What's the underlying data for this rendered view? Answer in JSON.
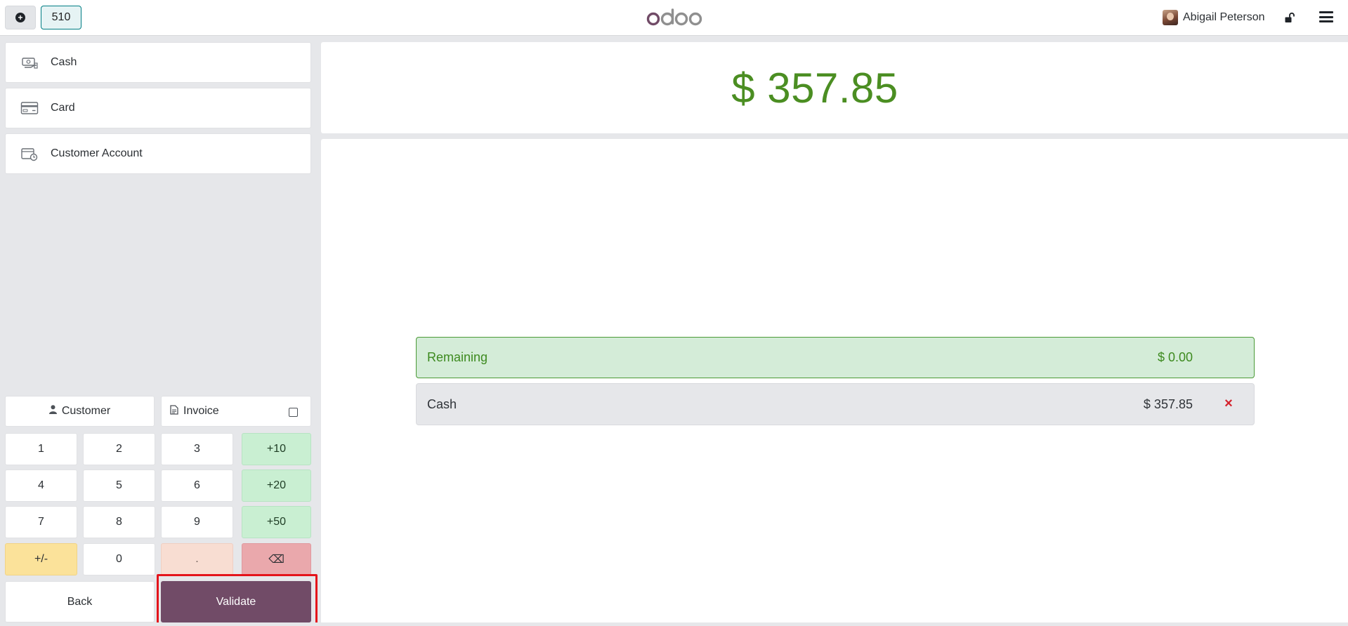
{
  "header": {
    "new_order_icon": "plus-circle-icon",
    "order_tab_label": "510",
    "logo_text": "odoo",
    "user_name": "Abigail Peterson",
    "lock_icon": "unlocked-icon",
    "menu_icon": "hamburger-icon"
  },
  "payment_methods": [
    {
      "label": "Cash",
      "icon": "cash-icon"
    },
    {
      "label": "Card",
      "icon": "credit-card-icon"
    },
    {
      "label": "Customer Account",
      "icon": "wallet-clock-icon"
    }
  ],
  "actions": {
    "customer_label": "Customer",
    "invoice_label": "Invoice",
    "invoice_checked": false
  },
  "numpad": {
    "keys": [
      "1",
      "2",
      "3",
      "+10",
      "4",
      "5",
      "6",
      "+20",
      "7",
      "8",
      "9",
      "+50",
      "+/-",
      "0",
      ".",
      "⌫"
    ]
  },
  "footer": {
    "back_label": "Back",
    "validate_label": "Validate"
  },
  "summary": {
    "total": "$ 357.85",
    "remaining_label": "Remaining",
    "remaining_amount": "$ 0.00",
    "payment_lines": [
      {
        "method": "Cash",
        "amount": "$ 357.85"
      }
    ],
    "delete_glyph": "×"
  },
  "colors": {
    "brand": "#714b67",
    "total_green": "#4b8e22",
    "remaining_bg": "#d4ecd8",
    "quick_add_green": "#c9efd2",
    "sign_yellow": "#fbe29a",
    "backspace_red": "#eaa8ac",
    "highlight_red": "#e4141b"
  }
}
